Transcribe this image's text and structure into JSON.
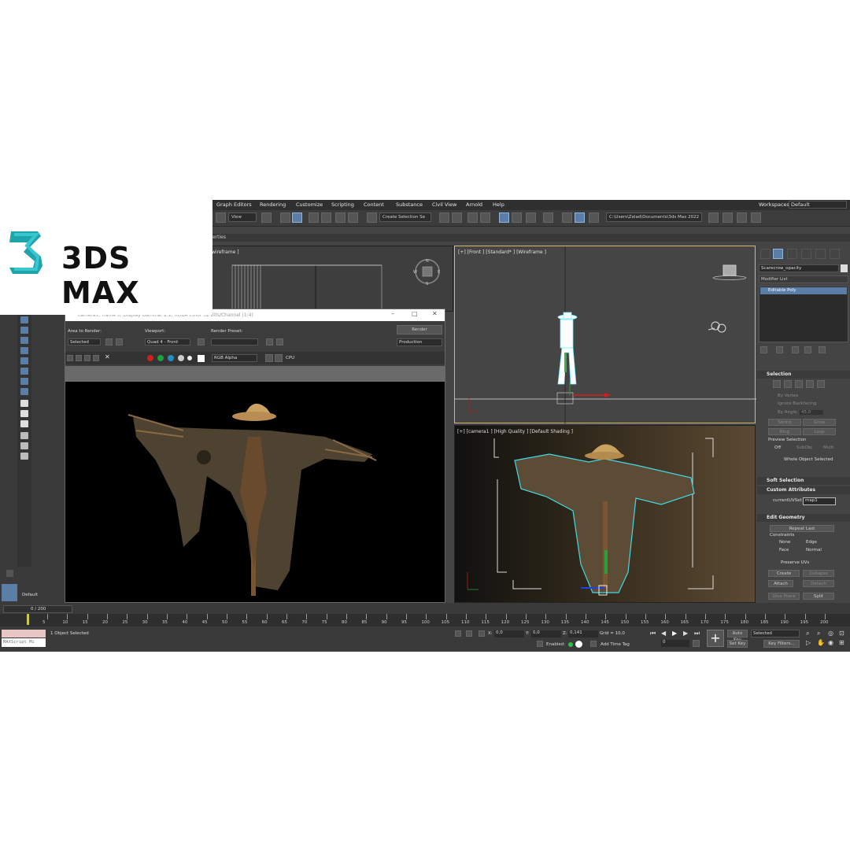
{
  "brand": {
    "name": "3DS MAX"
  },
  "menu": [
    "Graph Editors",
    "Rendering",
    "Customize",
    "Scripting",
    "Content",
    "Substance",
    "Civil View",
    "Arnold",
    "Help"
  ],
  "workspace": {
    "label": "Workspaces:",
    "value": "Default"
  },
  "toolbar": {
    "view_combo": "View",
    "selection_set": "Create Selection Se",
    "project_path": "C:\\Users\\Zelad\\Documents\\3ds Max 2022"
  },
  "ribbon": {
    "tab": "erties"
  },
  "viewports": {
    "top_left": {
      "label": "wireframe ]"
    },
    "front": {
      "label": "[+] [Front ] [Standard* ] [Wireframe ]"
    },
    "camera": {
      "label": "[+] [camera1 ] [High Quality ] [Default Shading ]"
    }
  },
  "render_window": {
    "title": "camera1, frame 0, Display Gamma: 2.2, RGBA Color 32 Bits/Channel (1:4)",
    "area_label": "Area to Render:",
    "area_value": "Selected",
    "viewport_label": "Viewport:",
    "viewport_value": "Quad 4 - Front",
    "preset_label": "Render Preset:",
    "preset_value": "",
    "render_button": "Render",
    "production": "Production",
    "channel": "RGB Alpha",
    "cpu": "CPU"
  },
  "command_panel": {
    "object_name": "Scarecrow_opacity",
    "modifier_list": "Modifier List",
    "stack_item": "Editable Poly",
    "selection": {
      "title": "Selection",
      "by_vertex": "By Vertex",
      "ignore_backfacing": "Ignore Backfacing",
      "by_angle": "By Angle:",
      "angle_value": "45,0",
      "shrink": "Shrink",
      "grow": "Grow",
      "ring": "Ring",
      "loop": "Loop",
      "preview": "Preview Selection",
      "off": "Off",
      "subobj": "SubObj",
      "multi": "Multi",
      "status": "Whole Object Selected"
    },
    "soft_selection": "Soft Selection",
    "custom_attributes": {
      "title": "Custom Attributes",
      "field_label": "currentUVSet",
      "field_value": "map1"
    },
    "edit_geometry": {
      "title": "Edit Geometry",
      "repeat_last": "Repeat Last",
      "constraints": "Constraints",
      "none": "None",
      "edge": "Edge",
      "face": "Face",
      "normal": "Normal",
      "preserve_uvs": "Preserve UVs",
      "create": "Create",
      "collapse": "Collapse",
      "attach": "Attach",
      "detach": "Detach",
      "slice_plane": "Slice Plane",
      "split": "Split"
    }
  },
  "left_panel": {
    "layer": "Default"
  },
  "timeline": {
    "frame_counter": "0 / 200",
    "ticks": [
      "5",
      "10",
      "15",
      "20",
      "25",
      "30",
      "35",
      "40",
      "45",
      "50",
      "55",
      "60",
      "65",
      "70",
      "75",
      "80",
      "85",
      "90",
      "95",
      "100",
      "105",
      "110",
      "115",
      "120",
      "125",
      "130",
      "135",
      "140",
      "145",
      "150",
      "155",
      "160",
      "165",
      "170",
      "175",
      "180",
      "185",
      "190",
      "195",
      "200"
    ]
  },
  "status": {
    "maxscript": "MAXScript Mi",
    "selected": "1 Object Selected",
    "x_label": "X:",
    "x": "0,0",
    "y_label": "Y:",
    "y": "0,0",
    "z_label": "Z:",
    "z": "0,141",
    "grid": "Grid = 10,0",
    "enabled": "Enabled:",
    "add_time_tag": "Add Time Tag",
    "frame_field": "0",
    "auto_key": "Auto Key",
    "set_key": "Set Key",
    "selected_combo": "Selected",
    "key_filters": "Key Filters..."
  }
}
